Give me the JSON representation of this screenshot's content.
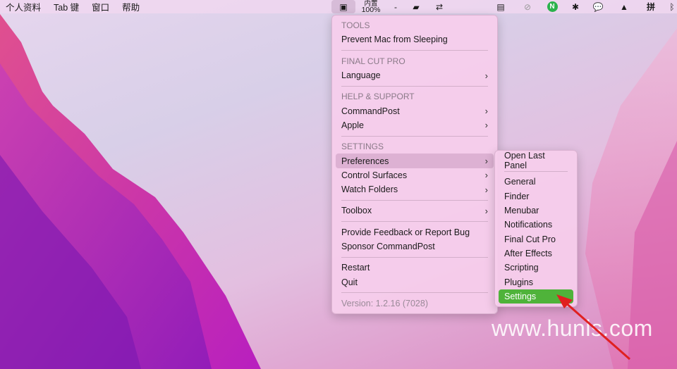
{
  "menubar": {
    "items": [
      "个人资料",
      "Tab 键",
      "窗口",
      "帮助"
    ],
    "battery_label": "内置",
    "battery_pct": "100%",
    "dash": "-"
  },
  "status_icons": [
    "commandpost-icon",
    "display-icon",
    "switch-icon",
    "card-icon",
    "mute-icon",
    "n-app-icon",
    "x-app-icon",
    "wechat-icon",
    "photos-icon",
    "pinyin-icon",
    "bluetooth-icon"
  ],
  "pinyin": "拼",
  "menu": {
    "tools_header": "TOOLS",
    "prevent_sleep": "Prevent Mac from Sleeping",
    "fcp_header": "FINAL CUT PRO",
    "language": "Language",
    "help_header": "HELP & SUPPORT",
    "commandpost": "CommandPost",
    "apple": "Apple",
    "settings_header": "SETTINGS",
    "preferences": "Preferences",
    "control_surfaces": "Control Surfaces",
    "watch_folders": "Watch Folders",
    "toolbox": "Toolbox",
    "feedback": "Provide Feedback or Report Bug",
    "sponsor": "Sponsor CommandPost",
    "restart": "Restart",
    "quit": "Quit",
    "version": "Version: 1.2.16 (7028)"
  },
  "submenu": {
    "items": [
      "Open Last Panel",
      "General",
      "Finder",
      "Menubar",
      "Notifications",
      "Final Cut Pro",
      "After Effects",
      "Scripting",
      "Plugins",
      "Settings"
    ]
  },
  "watermark": "www.hunls.com",
  "colors": {
    "highlight": "#4fb33a",
    "arrow": "#e02020"
  }
}
